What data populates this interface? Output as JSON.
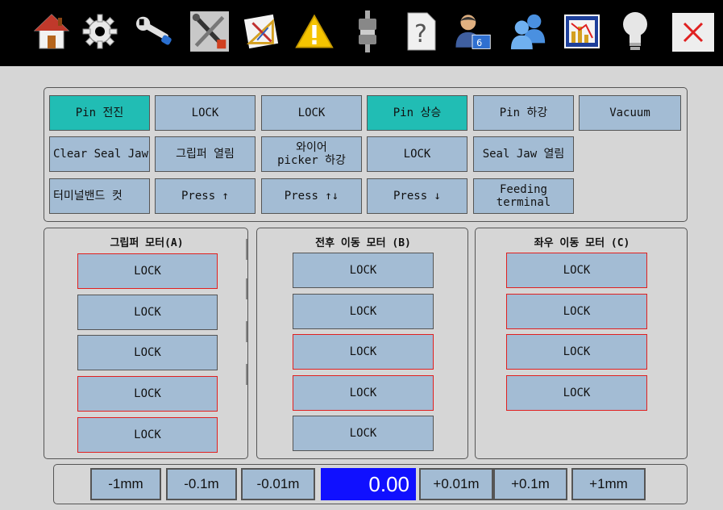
{
  "toolbar": {
    "icons": [
      "home-icon",
      "settings-gear-icon",
      "wrench-icon",
      "tools-icon",
      "drafting-icon",
      "warning-icon",
      "cable-connector-icon",
      "help-icon",
      "user-account-icon",
      "users-icon",
      "chart-icon",
      "lightbulb-icon",
      "close-icon"
    ],
    "user_badge": "6",
    "close_color": "#e02020",
    "warning_color": "#f5c400"
  },
  "function_grid": {
    "row1": [
      "Pin 전진",
      "LOCK",
      "LOCK",
      "Pin 상승",
      "Pin 하강",
      "Vacuum"
    ],
    "row2": [
      "Clear Seal Jaw",
      "그립퍼 열림",
      "와이어\npicker 하강",
      "LOCK",
      "Seal Jaw 열림"
    ],
    "row3": [
      "터미널밴드 컷",
      "Press ↑",
      "Press ↑↓",
      "Press ↓",
      "Feeding\nterminal"
    ],
    "active_color": "#21bdb4"
  },
  "motor_a": {
    "title": "그립퍼 모터(A)",
    "buttons": [
      "LOCK",
      "LOCK",
      "LOCK",
      "LOCK",
      "LOCK"
    ]
  },
  "motor_b": {
    "title": "전후 이동 모터 (B)",
    "buttons": [
      "LOCK",
      "LOCK",
      "LOCK",
      "LOCK",
      "LOCK"
    ]
  },
  "motor_c": {
    "title": "좌우 이동 모터 (C)",
    "buttons": [
      "LOCK",
      "LOCK",
      "LOCK",
      "LOCK"
    ]
  },
  "jog": {
    "minus_1mm": "-1mm",
    "minus_01": "-0.1m",
    "minus_001": "-0.01m",
    "value": "0.00",
    "plus_001": "+0.01m",
    "plus_01": "+0.1m",
    "plus_1mm": "+1mm"
  },
  "colors": {
    "button": "#a3bcd4",
    "value_bg": "#1010ff",
    "background": "#d6d6d6"
  }
}
